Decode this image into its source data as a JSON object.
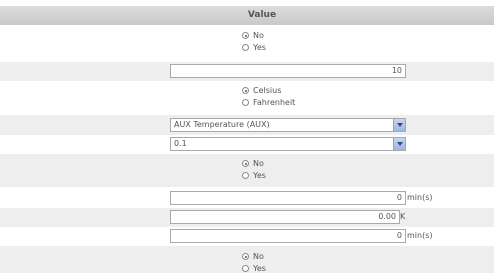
{
  "table": {
    "header": "Value",
    "rows": [
      {
        "type": "radio",
        "options": [
          "No",
          "Yes"
        ],
        "selected": 0
      },
      {
        "type": "text",
        "value": "10",
        "unit": ""
      },
      {
        "type": "radio",
        "options": [
          "Celsius",
          "Fahrenheit"
        ],
        "selected": 0
      },
      {
        "type": "select",
        "value": "AUX Temperature (AUX)"
      },
      {
        "type": "select",
        "value": "0.1"
      },
      {
        "type": "radio",
        "options": [
          "No",
          "Yes"
        ],
        "selected": 0
      },
      {
        "type": "text",
        "value": "0",
        "unit": "min(s)"
      },
      {
        "type": "text",
        "value": "0.00",
        "unit": "K"
      },
      {
        "type": "text",
        "value": "0",
        "unit": "min(s)"
      },
      {
        "type": "radio",
        "options": [
          "No",
          "Yes"
        ],
        "selected": 0
      }
    ]
  }
}
